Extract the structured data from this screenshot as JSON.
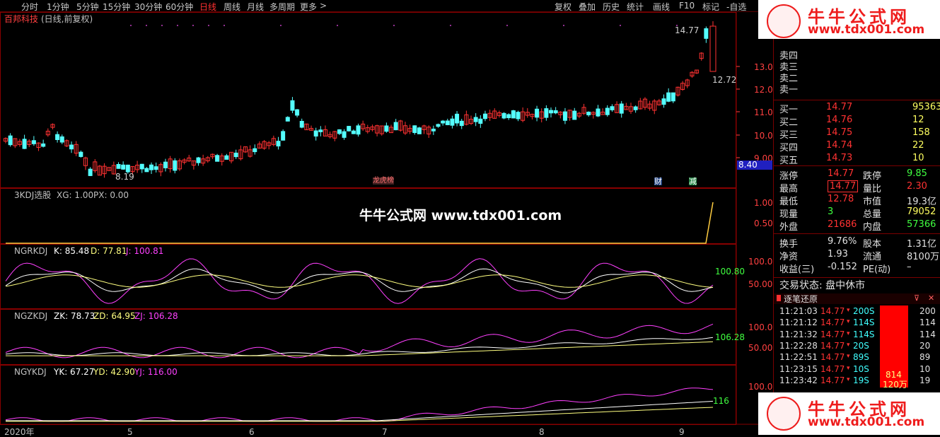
{
  "toolbar": {
    "periods": [
      "分时",
      "1分钟",
      "5分钟",
      "15分钟",
      "30分钟",
      "60分钟",
      "日线",
      "周线",
      "月线",
      "多周期",
      "更多"
    ],
    "more_chevron": ">",
    "active": "日线",
    "tools": [
      "复权",
      "叠加",
      "历史",
      "统计",
      "画线",
      "F10",
      "标记",
      "-自选"
    ]
  },
  "stock": {
    "name": "百邦科技",
    "mode": "(日线,前复权)"
  },
  "price_axis": [
    "13.00",
    "12.00",
    "11.00",
    "10.00",
    "9.00"
  ],
  "price_labels": {
    "high": "14.77",
    "current": "12.72",
    "low": "8.19",
    "last_box": "8.40"
  },
  "event_tags": {
    "lhb": "龙虎榜",
    "cai": "财",
    "jian": "减"
  },
  "panel1": {
    "name": "3KDJ选股",
    "xg": "XG: 1.00",
    "px": "PX: 0.00",
    "axis": [
      "1.00",
      "0.50"
    ]
  },
  "watermark": "牛牛公式网  www.tdx001.com",
  "panel2": {
    "name": "NGRKDJ",
    "k": "K: 85.48",
    "d": "D: 77.81",
    "j": "J: 100.81",
    "axis": [
      "100.0",
      "50.00"
    ],
    "last": "100.80"
  },
  "panel3": {
    "name": "NGZKDJ",
    "zk": "ZK: 78.73",
    "zd": "ZD: 64.95",
    "zj": "ZJ: 106.28",
    "axis": [
      "100.0",
      "50.00"
    ],
    "last": "106.28"
  },
  "panel4": {
    "name": "NGYKDJ",
    "yk": "YK: 67.27",
    "yd": "YD: 42.90",
    "yj": "YJ: 116.00",
    "axis": [
      "100.0"
    ],
    "last": "116"
  },
  "dates": [
    "2020年",
    "5",
    "6",
    "7",
    "8",
    "9"
  ],
  "logo": {
    "title": "牛牛公式网",
    "url": "www.tdx001.com"
  },
  "orderbook": {
    "sells": [
      "卖四",
      "卖三",
      "卖二",
      "卖一"
    ],
    "buys": [
      {
        "label": "买一",
        "price": "14.77",
        "vol": "95363"
      },
      {
        "label": "买二",
        "price": "14.76",
        "vol": "12"
      },
      {
        "label": "买三",
        "price": "14.75",
        "vol": "158"
      },
      {
        "label": "买四",
        "price": "14.74",
        "vol": "22"
      },
      {
        "label": "买五",
        "price": "14.73",
        "vol": "10"
      }
    ]
  },
  "quote": [
    {
      "l1": "涨停",
      "v1": "14.77",
      "l2": "跌停",
      "v2": "9.85"
    },
    {
      "l1": "最高",
      "v1": "14.77",
      "l2": "量比",
      "v2": "2.30"
    },
    {
      "l1": "最低",
      "v1": "12.78",
      "l2": "市值",
      "v2": "19.3亿"
    },
    {
      "l1": "现量",
      "v1": "3",
      "l2": "总量",
      "v2": "79052"
    },
    {
      "l1": "外盘",
      "v1": "21686",
      "l2": "内盘",
      "v2": "57366"
    }
  ],
  "fund": [
    {
      "l1": "换手",
      "v1": "9.76%",
      "l2": "股本",
      "v2": "1.31亿"
    },
    {
      "l1": "净资",
      "v1": "1.93",
      "l2": "流通",
      "v2": "8100万"
    },
    {
      "l1": "收益(三)",
      "v1": "-0.152",
      "l2": "PE(动)",
      "v2": "–"
    }
  ],
  "trade_status": "交易状态: 盘中休市",
  "tick_header": "逐笔还原",
  "ticks": [
    {
      "t": "11:21:03",
      "p": "14.77",
      "v": "200S",
      "r": "200"
    },
    {
      "t": "11:21:12",
      "p": "14.77",
      "v": "114S",
      "r": "114"
    },
    {
      "t": "11:21:32",
      "p": "14.77",
      "v": "114S",
      "r": "114"
    },
    {
      "t": "11:22:28",
      "p": "14.77",
      "v": "20S",
      "r": "20"
    },
    {
      "t": "11:22:51",
      "p": "14.77",
      "v": "89S",
      "r": "89"
    },
    {
      "t": "11:23:15",
      "p": "14.77",
      "v": "10S",
      "r": "10"
    },
    {
      "t": "11:23:42",
      "p": "14.77",
      "v": "19S",
      "r": "19"
    }
  ],
  "tick_bar_labels": [
    "814",
    "120万"
  ],
  "colors": {
    "up": "#ff3232",
    "down": "#54ffff",
    "k": "#ffffff",
    "d": "#ffff80",
    "j": "#ff40ff",
    "grid": "#880000"
  }
}
